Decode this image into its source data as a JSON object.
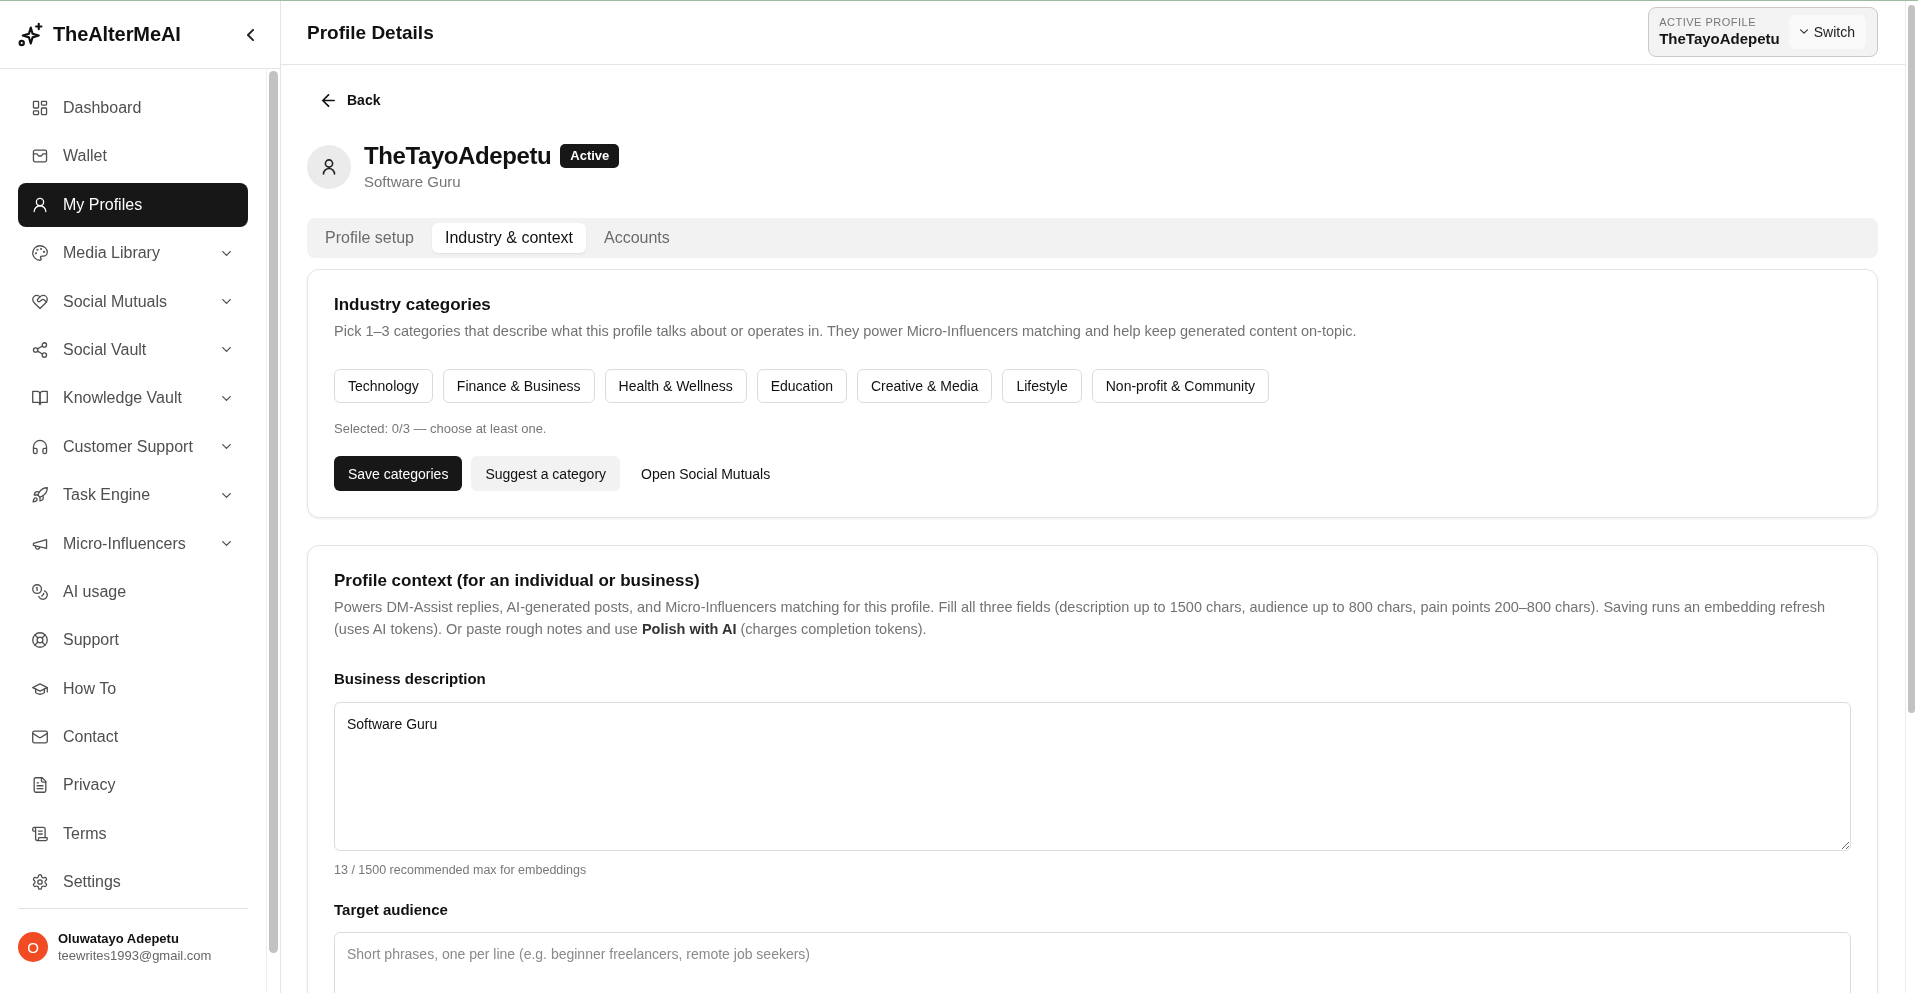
{
  "sidebar": {
    "logo": "TheAlterMeAI",
    "items": [
      {
        "label": "Dashboard",
        "selected": false,
        "expandable": false
      },
      {
        "label": "Wallet",
        "selected": false,
        "expandable": false
      },
      {
        "label": "My Profiles",
        "selected": true,
        "expandable": false
      },
      {
        "label": "Media Library",
        "selected": false,
        "expandable": true
      },
      {
        "label": "Social Mutuals",
        "selected": false,
        "expandable": true
      },
      {
        "label": "Social Vault",
        "selected": false,
        "expandable": true
      },
      {
        "label": "Knowledge Vault",
        "selected": false,
        "expandable": true
      },
      {
        "label": "Customer Support",
        "selected": false,
        "expandable": true
      },
      {
        "label": "Task Engine",
        "selected": false,
        "expandable": true
      },
      {
        "label": "Micro-Influencers",
        "selected": false,
        "expandable": true
      },
      {
        "label": "AI usage",
        "selected": false,
        "expandable": false
      },
      {
        "label": "Support",
        "selected": false,
        "expandable": false
      },
      {
        "label": "How To",
        "selected": false,
        "expandable": false
      },
      {
        "label": "Contact",
        "selected": false,
        "expandable": false
      },
      {
        "label": "Privacy",
        "selected": false,
        "expandable": false
      },
      {
        "label": "Terms",
        "selected": false,
        "expandable": false
      },
      {
        "label": "Settings",
        "selected": false,
        "expandable": false
      }
    ],
    "user": {
      "initial": "O",
      "name": "Oluwatayo Adepetu",
      "email": "teewrites1993@gmail.com"
    }
  },
  "header": {
    "title": "Profile Details",
    "active_profile": {
      "label": "ACTIVE PROFILE",
      "name": "TheTayoAdepetu",
      "switch": "Switch"
    }
  },
  "back": "Back",
  "profile": {
    "name": "TheTayoAdepetu",
    "status": "Active",
    "subtitle": "Software Guru"
  },
  "tabs": [
    {
      "label": "Profile setup",
      "selected": false
    },
    {
      "label": "Industry & context",
      "selected": true
    },
    {
      "label": "Accounts",
      "selected": false
    }
  ],
  "industry_card": {
    "title": "Industry categories",
    "description": "Pick 1–3 categories that describe what this profile talks about or operates in. They power Micro-Influencers matching and help keep generated content on-topic.",
    "categories": [
      {
        "label": "Technology",
        "selected": false
      },
      {
        "label": "Finance & Business",
        "selected": false
      },
      {
        "label": "Health & Wellness",
        "selected": false
      },
      {
        "label": "Education",
        "selected": false
      },
      {
        "label": "Creative & Media",
        "selected": false
      },
      {
        "label": "Lifestyle",
        "selected": false
      },
      {
        "label": "Non-profit & Community",
        "selected": false
      }
    ],
    "selection_note": "Selected: 0/3 — choose at least one.",
    "buttons": [
      {
        "label": "Save categories",
        "kind": "primary"
      },
      {
        "label": "Suggest a category",
        "kind": "secondary"
      },
      {
        "label": "Open Social Mutuals",
        "kind": "link"
      }
    ]
  },
  "context_card": {
    "title": "Profile context (for an individual or business)",
    "description": "Powers DM-Assist replies, AI-generated posts, and Micro-Influencers matching for this profile. Fill all three fields (description up to 1500 chars, audience up to 800 chars, pain points 200–800 chars). Saving runs an embedding refresh (uses AI tokens). Or paste rough notes and use **Polish with AI** (charges completion tokens).",
    "fields": [
      {
        "label": "Business description",
        "value": "Software Guru",
        "hint": "13 / 1500 recommended max for embeddings"
      },
      {
        "label": "Target audience",
        "placeholder": "Short phrases, one per line (e.g. beginner freelancers, remote job seekers)"
      }
    ]
  }
}
